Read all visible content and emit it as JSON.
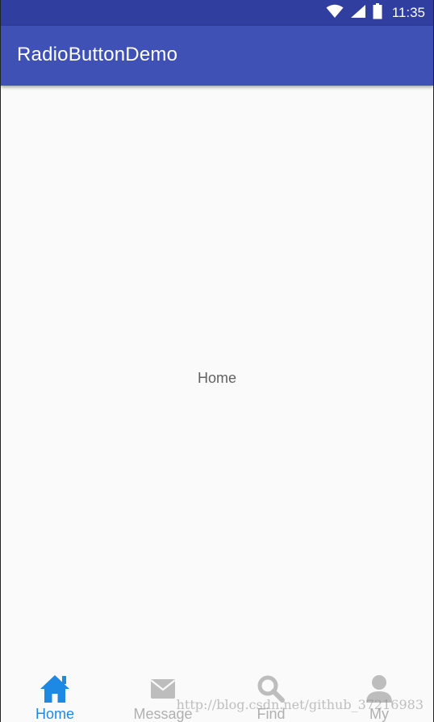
{
  "status_bar": {
    "time": "11:35",
    "icons": [
      "wifi-icon",
      "cell-signal-icon",
      "battery-icon"
    ]
  },
  "app_bar": {
    "title": "RadioButtonDemo"
  },
  "content": {
    "text": "Home"
  },
  "bottom_nav": {
    "items": [
      {
        "label": "Home",
        "icon": "home-icon",
        "selected": true
      },
      {
        "label": "Message",
        "icon": "envelope-icon",
        "selected": false
      },
      {
        "label": "Find",
        "icon": "search-icon",
        "selected": false
      },
      {
        "label": "My",
        "icon": "person-icon",
        "selected": false
      }
    ]
  },
  "watermark": {
    "text": "http://blog.csdn.net/github_37216983"
  },
  "colors": {
    "status_bar": "#303f9f",
    "app_bar": "#3f51b5",
    "active": "#1e88e5",
    "inactive": "#b0b0b0",
    "background": "#fafafa"
  }
}
